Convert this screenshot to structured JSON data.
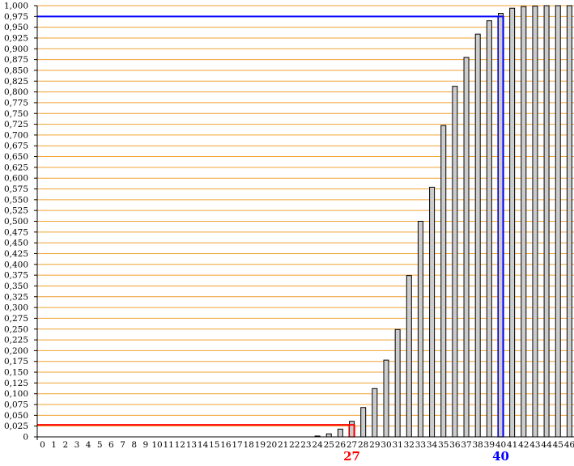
{
  "chart_data": {
    "type": "bar",
    "title": "",
    "xlabel": "",
    "ylabel": "",
    "categories": [
      "0",
      "1",
      "2",
      "3",
      "4",
      "5",
      "6",
      "7",
      "8",
      "9",
      "10",
      "11",
      "12",
      "13",
      "14",
      "15",
      "16",
      "17",
      "18",
      "19",
      "20",
      "21",
      "22",
      "23",
      "24",
      "25",
      "26",
      "27",
      "28",
      "29",
      "30",
      "31",
      "32",
      "33",
      "34",
      "35",
      "36",
      "37",
      "38",
      "39",
      "40",
      "41",
      "42",
      "43",
      "44",
      "45",
      "46"
    ],
    "values": [
      0,
      0,
      0,
      0,
      0,
      0,
      0,
      0,
      0,
      0,
      0,
      0,
      0,
      0,
      0,
      0,
      0,
      0,
      0,
      0,
      0,
      0,
      0,
      0,
      0.002,
      0.007,
      0.018,
      0.036,
      0.068,
      0.112,
      0.178,
      0.249,
      0.374,
      0.5,
      0.579,
      0.722,
      0.813,
      0.88,
      0.934,
      0.965,
      0.982,
      0.994,
      0.998,
      0.999,
      1.0,
      1.0,
      1.0
    ],
    "ylim": [
      0,
      1.0
    ],
    "y_ticks": [
      "0",
      "0,025",
      "0,050",
      "0,075",
      "0,100",
      "0,125",
      "0,150",
      "0,175",
      "0,200",
      "0,225",
      "0,250",
      "0,275",
      "0,300",
      "0,325",
      "0,350",
      "0,375",
      "0,400",
      "0,425",
      "0,450",
      "0,475",
      "0,500",
      "0,525",
      "0,550",
      "0,575",
      "0,600",
      "0,625",
      "0,650",
      "0,675",
      "0,700",
      "0,725",
      "0,750",
      "0,775",
      "0,800",
      "0,825",
      "0,850",
      "0,875",
      "0,900",
      "0,925",
      "0,950",
      "0,975",
      "1,000"
    ],
    "grid": true,
    "colors": {
      "grid": "#f0a030",
      "bar_fill": "#cccccc",
      "bar_stroke": "#000000",
      "lower_marker": "#ff0000",
      "upper_marker": "#0000ff"
    },
    "markers": [
      {
        "name": "lower",
        "category": "27",
        "y": 0.028,
        "label": "27",
        "color": "#ff0000"
      },
      {
        "name": "upper",
        "category": "40",
        "y": 0.975,
        "label": "40",
        "color": "#0000ff"
      }
    ]
  }
}
